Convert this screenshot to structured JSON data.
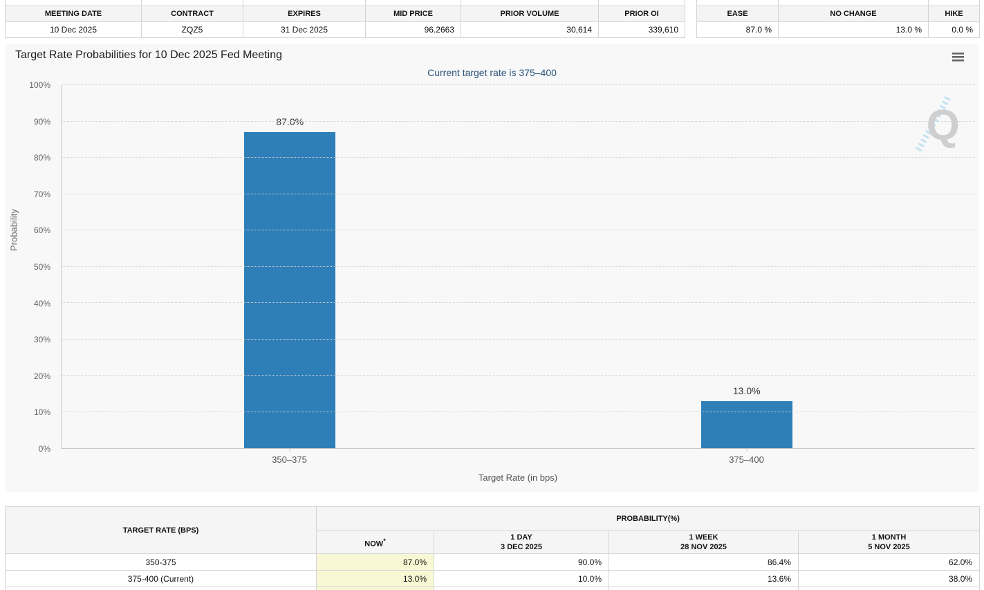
{
  "contract_table": {
    "headers": [
      "MEETING DATE",
      "CONTRACT",
      "EXPIRES",
      "MID PRICE",
      "PRIOR VOLUME",
      "PRIOR OI"
    ],
    "row": [
      "10 Dec 2025",
      "ZQZ5",
      "31 Dec 2025",
      "96.2663",
      "30,614",
      "339,610"
    ]
  },
  "action_table": {
    "headers": [
      "EASE",
      "NO CHANGE",
      "HIKE"
    ],
    "row": [
      "87.0 %",
      "13.0 %",
      "0.0 %"
    ]
  },
  "chart": {
    "title": "Target Rate Probabilities for 10 Dec 2025 Fed Meeting",
    "subtitle": "Current target rate is 375–400",
    "watermark_letter": "Q"
  },
  "chart_data": {
    "type": "bar",
    "title": "Target Rate Probabilities for 10 Dec 2025 Fed Meeting",
    "subtitle": "Current target rate is 375–400",
    "categories": [
      "350–375",
      "375–400"
    ],
    "values": [
      87.0,
      13.0
    ],
    "value_labels": [
      "87.0%",
      "13.0%"
    ],
    "xlabel": "Target Rate (in bps)",
    "ylabel": "Probability",
    "ylim": [
      0,
      100
    ],
    "ytick_step": 10,
    "ytick_suffix": "%",
    "grid": "dotted-horizontal",
    "legend": "none",
    "bar_color": "#2e7fb8"
  },
  "probability_table": {
    "col1_header": "TARGET RATE (BPS)",
    "group_header": "PROBABILITY(%)",
    "now_header": "NOW",
    "now_asterisk": "*",
    "period_headers": [
      {
        "label": "1 DAY",
        "date": "3 DEC 2025"
      },
      {
        "label": "1 WEEK",
        "date": "28 NOV 2025"
      },
      {
        "label": "1 MONTH",
        "date": "5 NOV 2025"
      }
    ],
    "rows": [
      {
        "target_rate": "350-375",
        "now": "87.0%",
        "one_day": "90.0%",
        "one_week": "86.4%",
        "one_month": "62.0%"
      },
      {
        "target_rate": "375-400 (Current)",
        "now": "13.0%",
        "one_day": "10.0%",
        "one_week": "13.6%",
        "one_month": "38.0%"
      }
    ]
  }
}
